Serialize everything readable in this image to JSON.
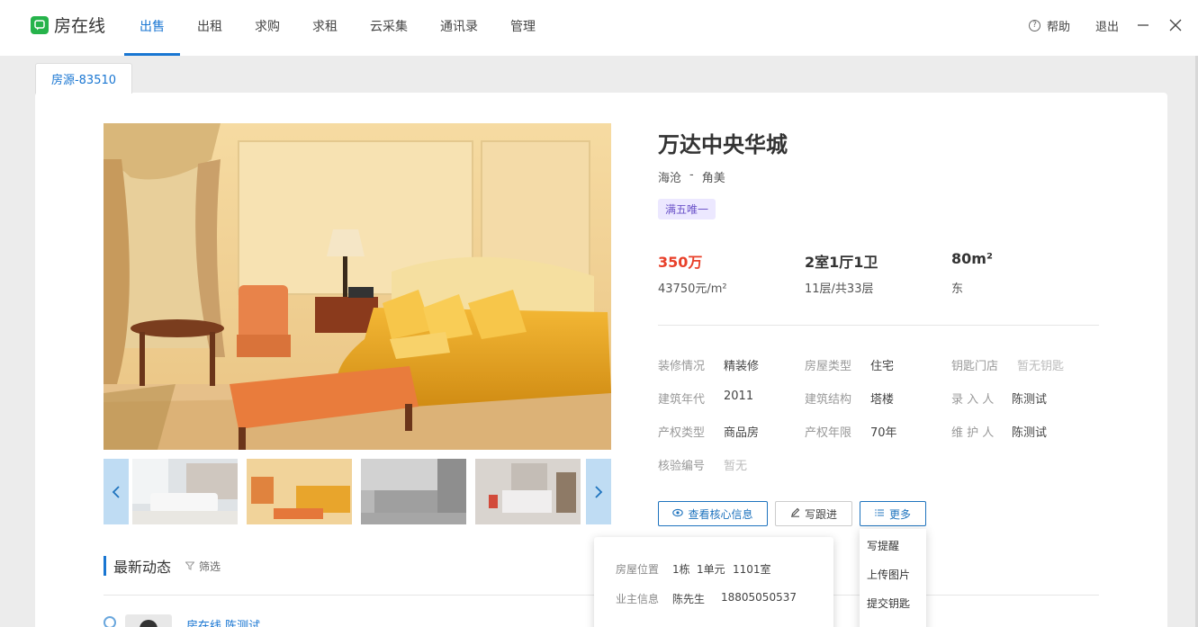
{
  "app": {
    "name": "房在线",
    "brand_color": "#26b34b"
  },
  "nav": {
    "items": [
      {
        "label": "出售",
        "active": true
      },
      {
        "label": "出租"
      },
      {
        "label": "求购"
      },
      {
        "label": "求租"
      },
      {
        "label": "云采集"
      },
      {
        "label": "通讯录"
      },
      {
        "label": "管理"
      }
    ]
  },
  "top_right": {
    "help": "帮助",
    "logout": "退出",
    "minimize_icon": "minimize-icon",
    "close_icon": "close-icon"
  },
  "tab": {
    "label": "房源-83510"
  },
  "property": {
    "title": "万达中央华城",
    "district": "海沧",
    "separator": "-",
    "area": "角美",
    "tag": "满五唯一",
    "price": "350万",
    "unit_price": "43750元/m²",
    "layout": "2室1厅1卫",
    "floor": "11层/共33层",
    "size": "80m²",
    "orientation": "东"
  },
  "attributes": [
    {
      "label": "装修情况",
      "value": "精装修"
    },
    {
      "label": "房屋类型",
      "value": "住宅"
    },
    {
      "label": "钥匙门店",
      "value": "暂无钥匙",
      "muted": true
    },
    {
      "label": "建筑年代",
      "value": "2011"
    },
    {
      "label": "建筑结构",
      "value": "塔楼"
    },
    {
      "label": "录 入 人",
      "value": "陈测试"
    },
    {
      "label": "产权类型",
      "value": "商品房"
    },
    {
      "label": "产权年限",
      "value": "70年"
    },
    {
      "label": "维 护 人",
      "value": "陈测试"
    },
    {
      "label": "核验编号",
      "value": "暂无",
      "muted": true
    }
  ],
  "actions": {
    "core_info": "查看核心信息",
    "follow_up": "写跟进",
    "more": "更多"
  },
  "popover": {
    "location_label": "房屋位置",
    "location_building": "1栋",
    "location_unit": "1单元",
    "location_room": "1101室",
    "owner_label": "业主信息",
    "owner_name": "陈先生",
    "owner_phone": "18805050537"
  },
  "more_menu": [
    "写提醒",
    "上传图片",
    "提交钥匙"
  ],
  "feed": {
    "section_title": "最新动态",
    "filter_label": "筛选",
    "first_author": "房在线 陈测试"
  },
  "colors": {
    "accent": "#1976d2",
    "price_red": "#e8402a",
    "tag_bg": "#ece8ff",
    "tag_text": "#6c54c9"
  }
}
